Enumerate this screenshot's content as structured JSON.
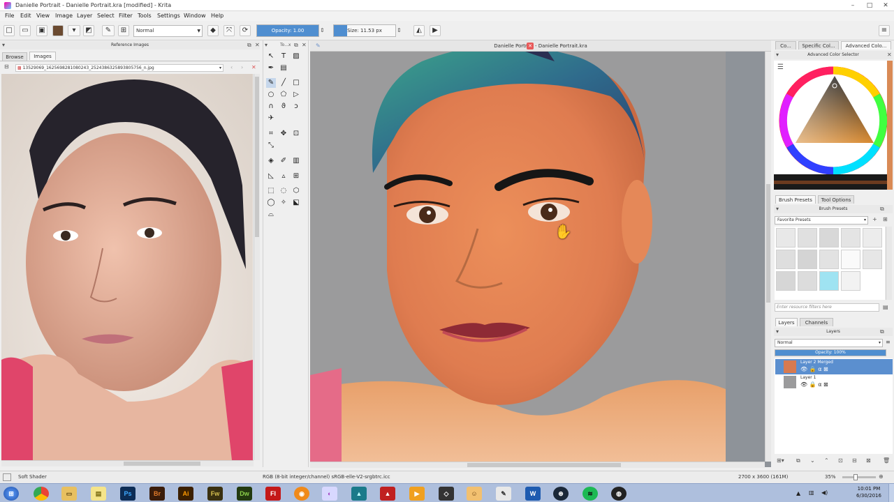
{
  "window": {
    "title": "Danielle Portrait - Danielle Portrait.kra [modified] - Krita",
    "min": "–",
    "max": "□",
    "close": "✕"
  },
  "menu": [
    "File",
    "Edit",
    "View",
    "Image",
    "Layer",
    "Select",
    "Filter",
    "Tools",
    "Settings",
    "Window",
    "Help"
  ],
  "toolbar": {
    "blend_mode": "Normal",
    "opacity_label": "Opacity: 1.00",
    "size_label": "Size: 11.53 px"
  },
  "left_docker": {
    "title": "Reference Images",
    "tabs": [
      "Browse",
      "Images"
    ],
    "file_path": "13529069_1625698281080243_2524386325893805756_n.jpg"
  },
  "toolbox_title": "To...x",
  "canvas": {
    "tab_title": "Danielle Portrait - Danielle Portrait.kra"
  },
  "color_docker": {
    "tabs": [
      "Co...",
      "Specific Col...",
      "Advanced Colo..."
    ],
    "title": "Advanced Color Selector"
  },
  "brush_docker": {
    "tabs": [
      "Brush Presets",
      "Tool Options"
    ],
    "title": "Brush Presets",
    "filter_label": "Favorite Presets",
    "search_placeholder": "Enter resource filters here"
  },
  "layers_docker": {
    "tabs": [
      "Layers",
      "Channels"
    ],
    "title": "Layers",
    "blend_mode": "Normal",
    "opacity_label": "Opacity:  100%",
    "layers": [
      {
        "name": "Layer 2 Merged",
        "selected": true
      },
      {
        "name": "Layer 1",
        "selected": false
      }
    ]
  },
  "status": {
    "brush": "Soft Shader",
    "color_profile": "RGB (8-bit integer/channel)  sRGB-elle-V2-srgbtrc.icc",
    "dimensions": "2700 x 3600 (161M)",
    "zoom": "35%"
  },
  "taskbar": {
    "apps": [
      "start",
      "chrome",
      "explorer",
      "notes",
      "Ps",
      "Br",
      "Ai",
      "Fw",
      "Dw",
      "Fl",
      "blender",
      "krita",
      "app",
      "acrobat",
      "media",
      "unity",
      "finder",
      "pen",
      "W",
      "steam",
      "spotify",
      "obs"
    ],
    "time": "10:01 PM",
    "date": "6/30/2016"
  },
  "colors": {
    "accent": "#4f8ed0",
    "selected_layer": "#5b8fcf",
    "taskbar": "#aebfdd"
  }
}
